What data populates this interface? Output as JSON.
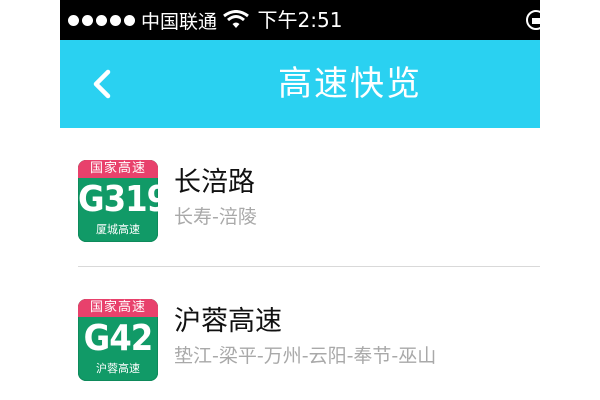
{
  "status_bar": {
    "carrier": "中国联通",
    "time": "下午2:51"
  },
  "nav": {
    "title": "高速快览",
    "back_icon": "chevron-left-icon"
  },
  "colors": {
    "nav_bg": "#2ad1f1",
    "badge_green": "#119a67",
    "badge_red": "#e8416c"
  },
  "highways": [
    {
      "badge_top": "国家高速",
      "code": "G319",
      "badge_bottom": "厦城高速",
      "name": "长涪路",
      "route": "长寿-涪陵"
    },
    {
      "badge_top": "国家高速",
      "code": "G42",
      "badge_bottom": "沪蓉高速",
      "name": "沪蓉高速",
      "route": "垫江-梁平-万州-云阳-奉节-巫山"
    }
  ]
}
